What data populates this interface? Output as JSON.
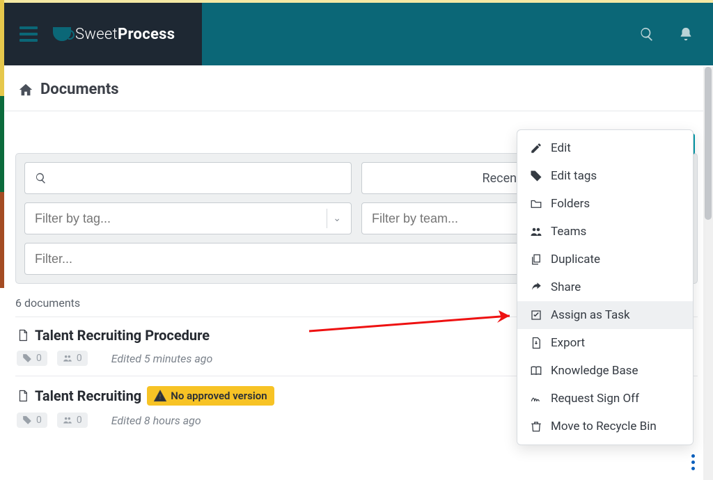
{
  "brand": {
    "name_light": "Sweet",
    "name_bold": "Process"
  },
  "page": {
    "title": "Documents"
  },
  "filters": {
    "search_placeholder": "",
    "sort_label": "Recently Edited",
    "tag_placeholder": "Filter by tag...",
    "team_placeholder": "Filter by team...",
    "generic_placeholder": "Filter..."
  },
  "count_text": "6 documents",
  "documents": [
    {
      "title": "Talent Recruiting Procedure",
      "badge": "",
      "tags_count": "0",
      "teams_count": "0",
      "edited_text": "Edited 5 minutes ago"
    },
    {
      "title": "Talent Recruiting",
      "badge": "No approved version",
      "tags_count": "0",
      "teams_count": "0",
      "edited_text": "Edited 8 hours ago"
    }
  ],
  "menu": {
    "edit": "Edit",
    "edit_tags": "Edit tags",
    "folders": "Folders",
    "teams": "Teams",
    "duplicate": "Duplicate",
    "share": "Share",
    "assign_task": "Assign as Task",
    "export": "Export",
    "knowledge_base": "Knowledge Base",
    "request_signoff": "Request Sign Off",
    "recycle": "Move to Recycle Bin"
  }
}
